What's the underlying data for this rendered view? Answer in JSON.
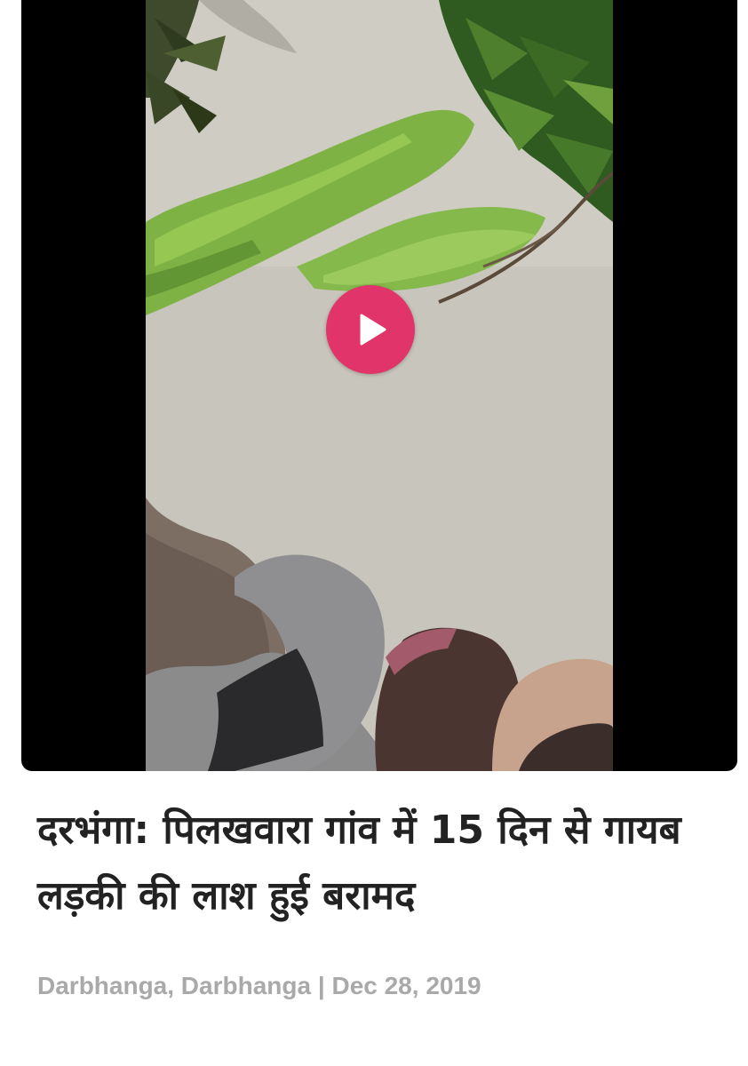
{
  "article": {
    "headline": "दरभंगा: पिलखवारा गांव में 15 दिन से गायब लड़की की लाश हुई बरामद",
    "location": "Darbhanga, Darbhanga",
    "separator": "|",
    "date": "Dec 28, 2019"
  },
  "video": {
    "play_icon": "play-icon",
    "play_button_color": "#e0346a",
    "letterbox_color": "#000000"
  },
  "colors": {
    "headline_text": "#222222",
    "meta_text": "#a9a9a9",
    "background": "#ffffff"
  }
}
